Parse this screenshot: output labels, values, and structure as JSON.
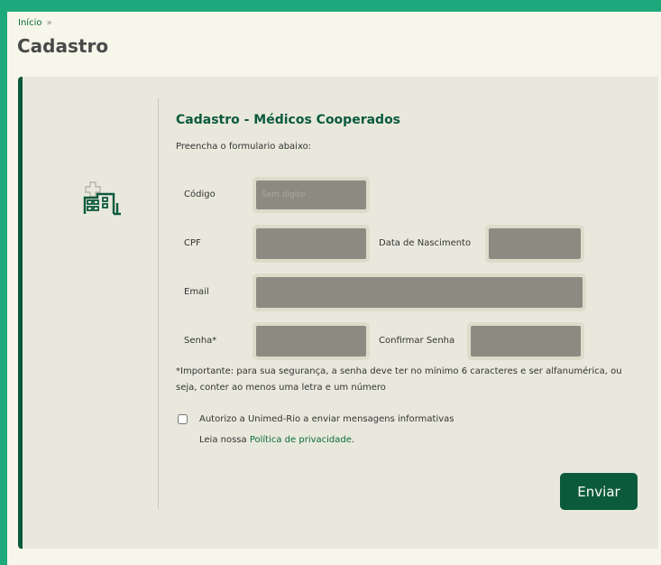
{
  "breadcrumb": {
    "home": "Início",
    "separator": "»"
  },
  "page_title": "Cadastro",
  "form": {
    "title": "Cadastro - Médicos Cooperados",
    "subtitle": "Preencha o formulario abaixo:",
    "codigo_label": "Código",
    "codigo_placeholder": "Sem dígito",
    "cpf_label": "CPF",
    "nascimento_label": "Data de Nascimento",
    "email_label": "Email",
    "senha_label": "Senha*",
    "confirmar_label": "Confirmar Senha",
    "note": "*Importante: para sua segurança, a senha deve ter no mínimo 6 caracteres e ser alfanumérica, ou seja, conter ao menos uma letra e um número",
    "consent_label": "Autorizo a Unimed-Rio a enviar mensagens informativas",
    "privacy_prefix": "Leia nossa",
    "privacy_link": "Política de privacidade",
    "privacy_suffix": ".",
    "submit_label": "Enviar"
  },
  "icon": "hospital-icon",
  "colors": {
    "frame": "#1ea97c",
    "page_bg": "#f7f6ea",
    "card_bg": "#e9e8dd",
    "accent": "#0c5a3c",
    "input_fill": "#8c8b81"
  }
}
